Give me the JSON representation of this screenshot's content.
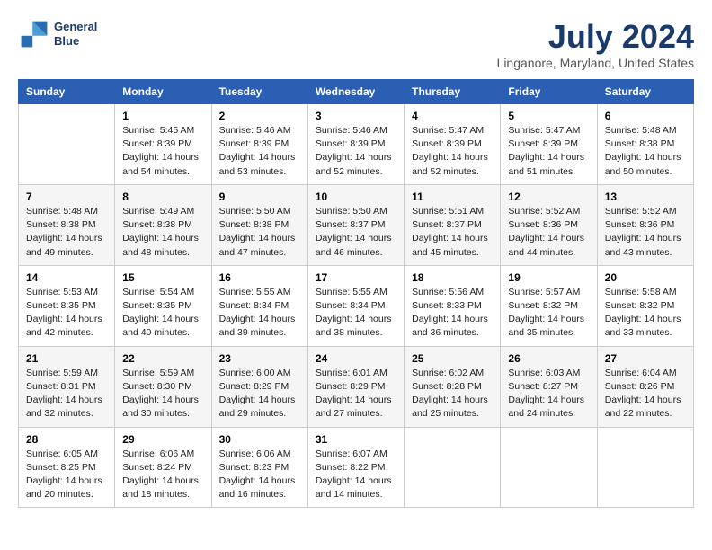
{
  "logo": {
    "line1": "General",
    "line2": "Blue"
  },
  "title": "July 2024",
  "subtitle": "Linganore, Maryland, United States",
  "days": [
    "Sunday",
    "Monday",
    "Tuesday",
    "Wednesday",
    "Thursday",
    "Friday",
    "Saturday"
  ],
  "weeks": [
    [
      {
        "date": "",
        "content": ""
      },
      {
        "date": "1",
        "content": "Sunrise: 5:45 AM\nSunset: 8:39 PM\nDaylight: 14 hours\nand 54 minutes."
      },
      {
        "date": "2",
        "content": "Sunrise: 5:46 AM\nSunset: 8:39 PM\nDaylight: 14 hours\nand 53 minutes."
      },
      {
        "date": "3",
        "content": "Sunrise: 5:46 AM\nSunset: 8:39 PM\nDaylight: 14 hours\nand 52 minutes."
      },
      {
        "date": "4",
        "content": "Sunrise: 5:47 AM\nSunset: 8:39 PM\nDaylight: 14 hours\nand 52 minutes."
      },
      {
        "date": "5",
        "content": "Sunrise: 5:47 AM\nSunset: 8:39 PM\nDaylight: 14 hours\nand 51 minutes."
      },
      {
        "date": "6",
        "content": "Sunrise: 5:48 AM\nSunset: 8:38 PM\nDaylight: 14 hours\nand 50 minutes."
      }
    ],
    [
      {
        "date": "7",
        "content": "Sunrise: 5:48 AM\nSunset: 8:38 PM\nDaylight: 14 hours\nand 49 minutes."
      },
      {
        "date": "8",
        "content": "Sunrise: 5:49 AM\nSunset: 8:38 PM\nDaylight: 14 hours\nand 48 minutes."
      },
      {
        "date": "9",
        "content": "Sunrise: 5:50 AM\nSunset: 8:38 PM\nDaylight: 14 hours\nand 47 minutes."
      },
      {
        "date": "10",
        "content": "Sunrise: 5:50 AM\nSunset: 8:37 PM\nDaylight: 14 hours\nand 46 minutes."
      },
      {
        "date": "11",
        "content": "Sunrise: 5:51 AM\nSunset: 8:37 PM\nDaylight: 14 hours\nand 45 minutes."
      },
      {
        "date": "12",
        "content": "Sunrise: 5:52 AM\nSunset: 8:36 PM\nDaylight: 14 hours\nand 44 minutes."
      },
      {
        "date": "13",
        "content": "Sunrise: 5:52 AM\nSunset: 8:36 PM\nDaylight: 14 hours\nand 43 minutes."
      }
    ],
    [
      {
        "date": "14",
        "content": "Sunrise: 5:53 AM\nSunset: 8:35 PM\nDaylight: 14 hours\nand 42 minutes."
      },
      {
        "date": "15",
        "content": "Sunrise: 5:54 AM\nSunset: 8:35 PM\nDaylight: 14 hours\nand 40 minutes."
      },
      {
        "date": "16",
        "content": "Sunrise: 5:55 AM\nSunset: 8:34 PM\nDaylight: 14 hours\nand 39 minutes."
      },
      {
        "date": "17",
        "content": "Sunrise: 5:55 AM\nSunset: 8:34 PM\nDaylight: 14 hours\nand 38 minutes."
      },
      {
        "date": "18",
        "content": "Sunrise: 5:56 AM\nSunset: 8:33 PM\nDaylight: 14 hours\nand 36 minutes."
      },
      {
        "date": "19",
        "content": "Sunrise: 5:57 AM\nSunset: 8:32 PM\nDaylight: 14 hours\nand 35 minutes."
      },
      {
        "date": "20",
        "content": "Sunrise: 5:58 AM\nSunset: 8:32 PM\nDaylight: 14 hours\nand 33 minutes."
      }
    ],
    [
      {
        "date": "21",
        "content": "Sunrise: 5:59 AM\nSunset: 8:31 PM\nDaylight: 14 hours\nand 32 minutes."
      },
      {
        "date": "22",
        "content": "Sunrise: 5:59 AM\nSunset: 8:30 PM\nDaylight: 14 hours\nand 30 minutes."
      },
      {
        "date": "23",
        "content": "Sunrise: 6:00 AM\nSunset: 8:29 PM\nDaylight: 14 hours\nand 29 minutes."
      },
      {
        "date": "24",
        "content": "Sunrise: 6:01 AM\nSunset: 8:29 PM\nDaylight: 14 hours\nand 27 minutes."
      },
      {
        "date": "25",
        "content": "Sunrise: 6:02 AM\nSunset: 8:28 PM\nDaylight: 14 hours\nand 25 minutes."
      },
      {
        "date": "26",
        "content": "Sunrise: 6:03 AM\nSunset: 8:27 PM\nDaylight: 14 hours\nand 24 minutes."
      },
      {
        "date": "27",
        "content": "Sunrise: 6:04 AM\nSunset: 8:26 PM\nDaylight: 14 hours\nand 22 minutes."
      }
    ],
    [
      {
        "date": "28",
        "content": "Sunrise: 6:05 AM\nSunset: 8:25 PM\nDaylight: 14 hours\nand 20 minutes."
      },
      {
        "date": "29",
        "content": "Sunrise: 6:06 AM\nSunset: 8:24 PM\nDaylight: 14 hours\nand 18 minutes."
      },
      {
        "date": "30",
        "content": "Sunrise: 6:06 AM\nSunset: 8:23 PM\nDaylight: 14 hours\nand 16 minutes."
      },
      {
        "date": "31",
        "content": "Sunrise: 6:07 AM\nSunset: 8:22 PM\nDaylight: 14 hours\nand 14 minutes."
      },
      {
        "date": "",
        "content": ""
      },
      {
        "date": "",
        "content": ""
      },
      {
        "date": "",
        "content": ""
      }
    ]
  ]
}
